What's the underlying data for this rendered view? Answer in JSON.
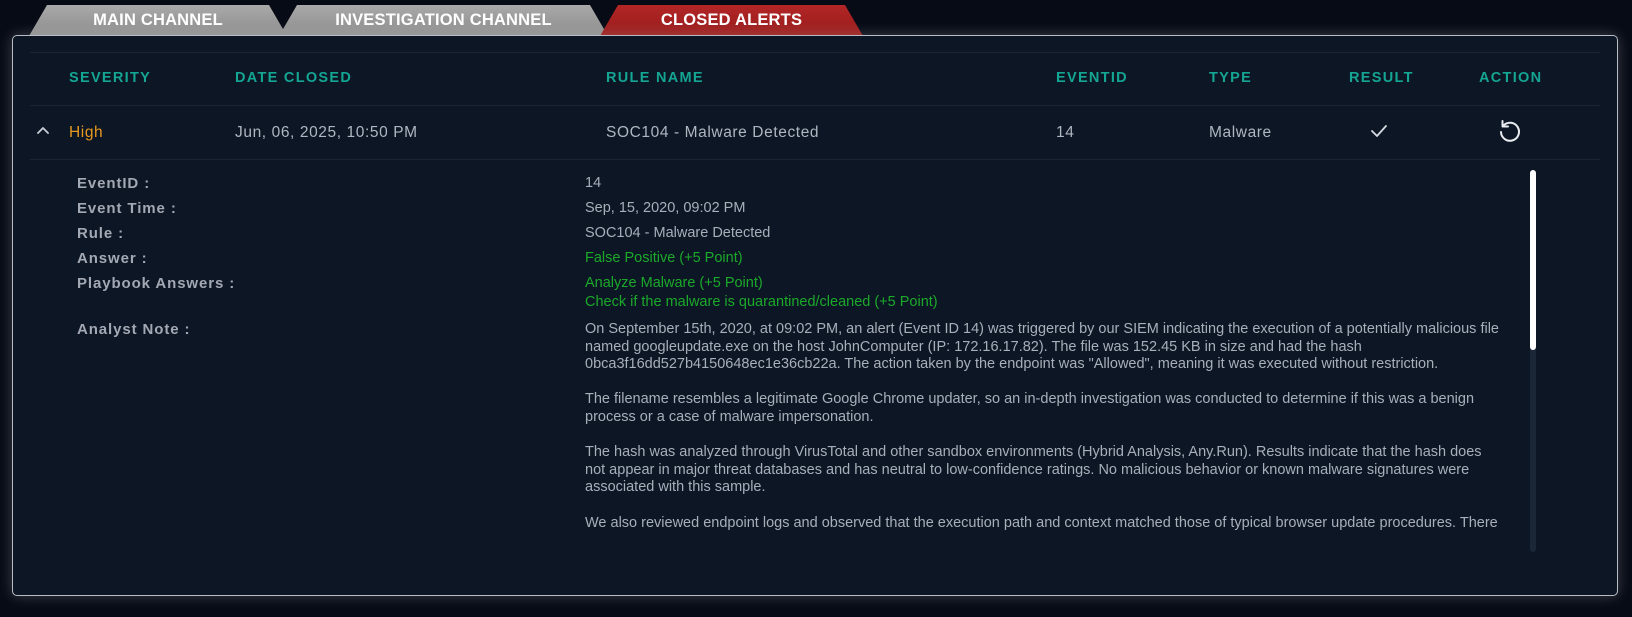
{
  "tabs": [
    {
      "label": "MAIN CHANNEL",
      "active": false
    },
    {
      "label": "INVESTIGATION CHANNEL",
      "active": false
    },
    {
      "label": "CLOSED ALERTS",
      "active": true
    }
  ],
  "table": {
    "headers": {
      "severity": "SEVERITY",
      "date_closed": "DATE CLOSED",
      "rule_name": "RULE NAME",
      "eventid": "EVENTID",
      "type": "TYPE",
      "result": "RESULT",
      "action": "ACTION"
    },
    "row": {
      "severity": "High",
      "date_closed": "Jun, 06, 2025, 10:50 PM",
      "rule_name": "SOC104 - Malware Detected",
      "eventid": "14",
      "type": "Malware",
      "result_icon": "checkmark-icon",
      "action_icon": "undo-icon"
    }
  },
  "details": {
    "labels": {
      "event_id": "EventID :",
      "event_time": "Event Time :",
      "rule": "Rule :",
      "answer": "Answer :",
      "playbook": "Playbook Answers :",
      "note": "Analyst Note :"
    },
    "event_id": "14",
    "event_time": "Sep, 15, 2020, 09:02 PM",
    "rule": "SOC104 - Malware Detected",
    "answer": "False Positive (+5 Point)",
    "playbook_answers": [
      "Analyze Malware (+5 Point)",
      "Check if the malware is quarantined/cleaned (+5 Point)"
    ],
    "analyst_note": [
      "On September 15th, 2020, at 09:02 PM, an alert (Event ID 14) was triggered by our SIEM indicating the execution of a potentially malicious file named googleupdate.exe on the host JohnComputer (IP: 172.16.17.82). The file was 152.45 KB in size and had the hash 0bca3f16dd527b4150648ec1e36cb22a. The action taken by the endpoint was \"Allowed\", meaning it was executed without restriction.",
      "The filename resembles a legitimate Google Chrome updater, so an in-depth investigation was conducted to determine if this was a benign process or a case of malware impersonation.",
      "The hash was analyzed through VirusTotal and other sandbox environments (Hybrid Analysis, Any.Run). Results indicate that the hash does not appear in major threat databases and has neutral to low-confidence ratings. No malicious behavior or known malware signatures were associated with this sample.",
      "We also reviewed endpoint logs and observed that the execution path and context matched those of typical browser update procedures. There was also browsing history consistent with legitimate use of Google services prior to the alert."
    ]
  },
  "colors": {
    "header_teal": "#14a593",
    "severity_high": "#e89a1f",
    "answer_green": "#1ba92a",
    "active_tab_red": "#b32626"
  }
}
